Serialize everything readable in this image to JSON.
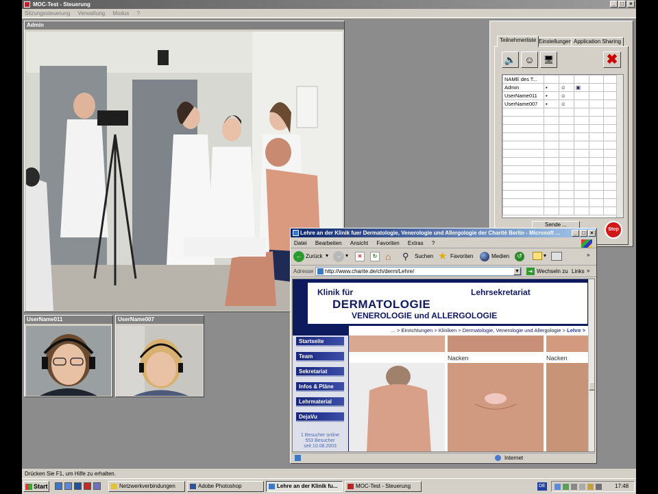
{
  "window": {
    "title": "MOC-Test - Steuerung",
    "controls": [
      "_",
      "□",
      "×"
    ]
  },
  "menu": [
    "Sitzungssteuerung",
    "Verwaltung",
    "Modus",
    "?"
  ],
  "videos": {
    "main_label": "Admin",
    "thumb1_label": "UserName011",
    "thumb2_label": "UserName007"
  },
  "participants": {
    "tabs": [
      "Teilnehmerliste",
      "Einstellungen",
      "Application Sharing"
    ],
    "column_name": "NAME des T...",
    "rows": [
      "Admin",
      "UserName011",
      "UserName007"
    ],
    "send_label": "Sende ...",
    "stop_label": "Stop"
  },
  "browser": {
    "title": "Lehre an der Klinik fuer Dermatologie, Venerologie und Allergologie der Charité Berlin - Microsoft ...",
    "menu": [
      "Datei",
      "Bearbeiten",
      "Ansicht",
      "Favoriten",
      "Extras",
      "?"
    ],
    "toolbar": {
      "back": "Zurück",
      "search": "Suchen",
      "favorites": "Favoriten",
      "media": "Medien"
    },
    "address_label": "Adresse",
    "address_value": "http://www.charite.de/ch/derm/Lehre/",
    "go_label": "Wechseln zu",
    "links_label": "Links",
    "status_zone": "Internet",
    "page": {
      "klinik": "Klinik für",
      "lehrsekretariat": "Lehrsekretariat",
      "dermatologie": "DERMATOLOGIE",
      "venerologie": "VENEROLOGIE und ALLERGOLOGIE",
      "breadcrumb_prefix": "... > Einrichtungen > Kliniken > Dermatologie, Venerologie und Allergologie > ",
      "breadcrumb_current": "Lehre >",
      "nav": [
        "Startseite",
        "Team",
        "Sekretariat",
        "Infos & Pläne",
        "Lehrmaterial",
        "DejaVu"
      ],
      "visitors_online": "1 Besucher online",
      "visitors_total": "553 Besucher",
      "visitors_since": "seit 10.08.2003",
      "caption1": "Nacken",
      "caption2": "Nacken"
    }
  },
  "statusbar": "Drücken Sie F1, um Hilfe zu erhalten.",
  "taskbar": {
    "start": "Start",
    "tasks": [
      "Netzwerkverbindungen",
      "Adobe Photoshop",
      "Lehre an der Klinik fu...",
      "MOC-Test - Steuerung"
    ],
    "lang": "DE",
    "clock": "17:48"
  }
}
